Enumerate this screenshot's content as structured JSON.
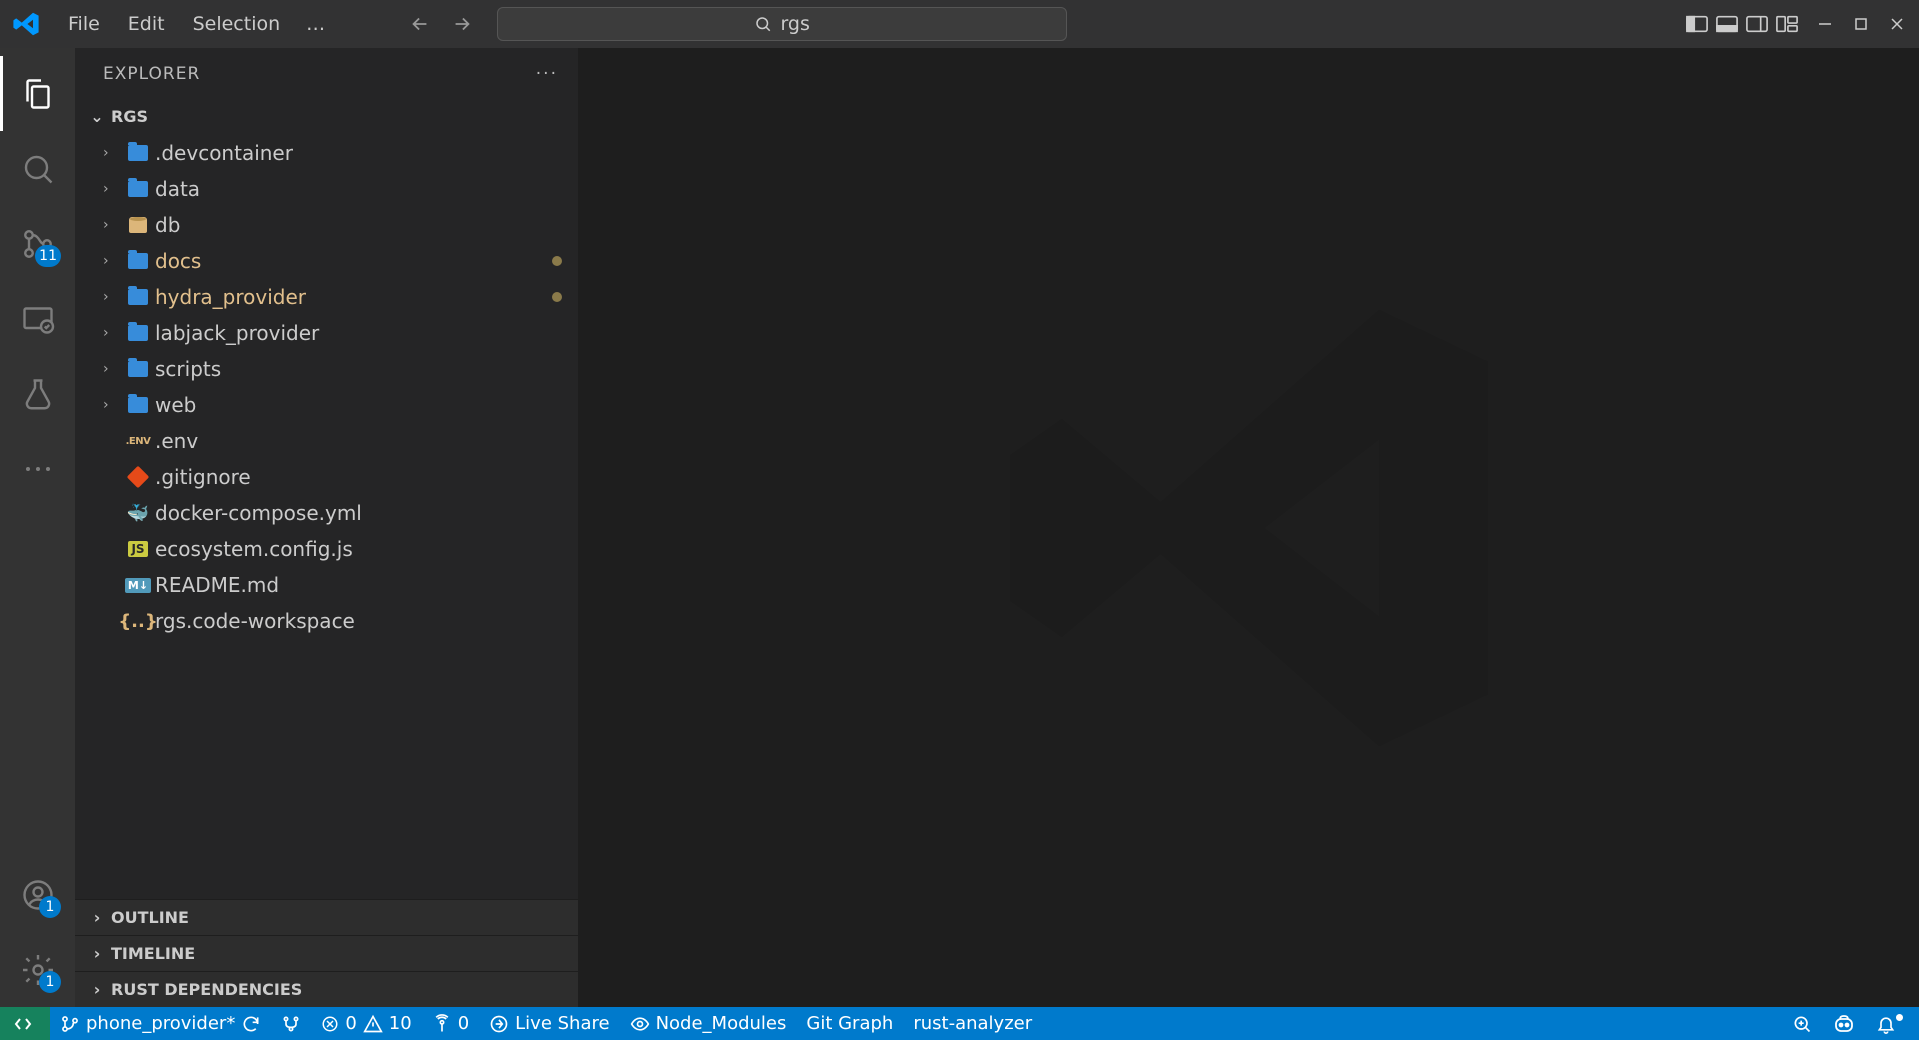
{
  "titlebar": {
    "menu": [
      "File",
      "Edit",
      "Selection"
    ],
    "ellipsis": "…",
    "search_label": "rgs"
  },
  "activitybar": {
    "source_control_badge": "11",
    "accounts_badge": "1",
    "settings_badge": "1"
  },
  "sidebar": {
    "title": "EXPLORER",
    "workspace": "RGS",
    "tree": [
      {
        "type": "folder",
        "name": ".devcontainer",
        "modified": false
      },
      {
        "type": "folder",
        "name": "data",
        "modified": false
      },
      {
        "type": "folder",
        "name": "db",
        "modified": false,
        "icon": "db"
      },
      {
        "type": "folder",
        "name": "docs",
        "modified": true
      },
      {
        "type": "folder",
        "name": "hydra_provider",
        "modified": true
      },
      {
        "type": "folder",
        "name": "labjack_provider",
        "modified": false
      },
      {
        "type": "folder",
        "name": "scripts",
        "modified": false
      },
      {
        "type": "folder",
        "name": "web",
        "modified": false
      },
      {
        "type": "file",
        "name": ".env",
        "icon": "env"
      },
      {
        "type": "file",
        "name": ".gitignore",
        "icon": "git"
      },
      {
        "type": "file",
        "name": "docker-compose.yml",
        "icon": "docker"
      },
      {
        "type": "file",
        "name": "ecosystem.config.js",
        "icon": "js"
      },
      {
        "type": "file",
        "name": "README.md",
        "icon": "md"
      },
      {
        "type": "file",
        "name": "rgs.code-workspace",
        "icon": "json"
      }
    ],
    "sections": [
      "OUTLINE",
      "TIMELINE",
      "RUST DEPENDENCIES"
    ]
  },
  "statusbar": {
    "branch": "phone_provider*",
    "errors": "0",
    "warnings": "10",
    "ports": "0",
    "liveshare": "Live Share",
    "node_modules": "Node_Modules",
    "gitgraph": "Git Graph",
    "rust": "rust-analyzer"
  }
}
